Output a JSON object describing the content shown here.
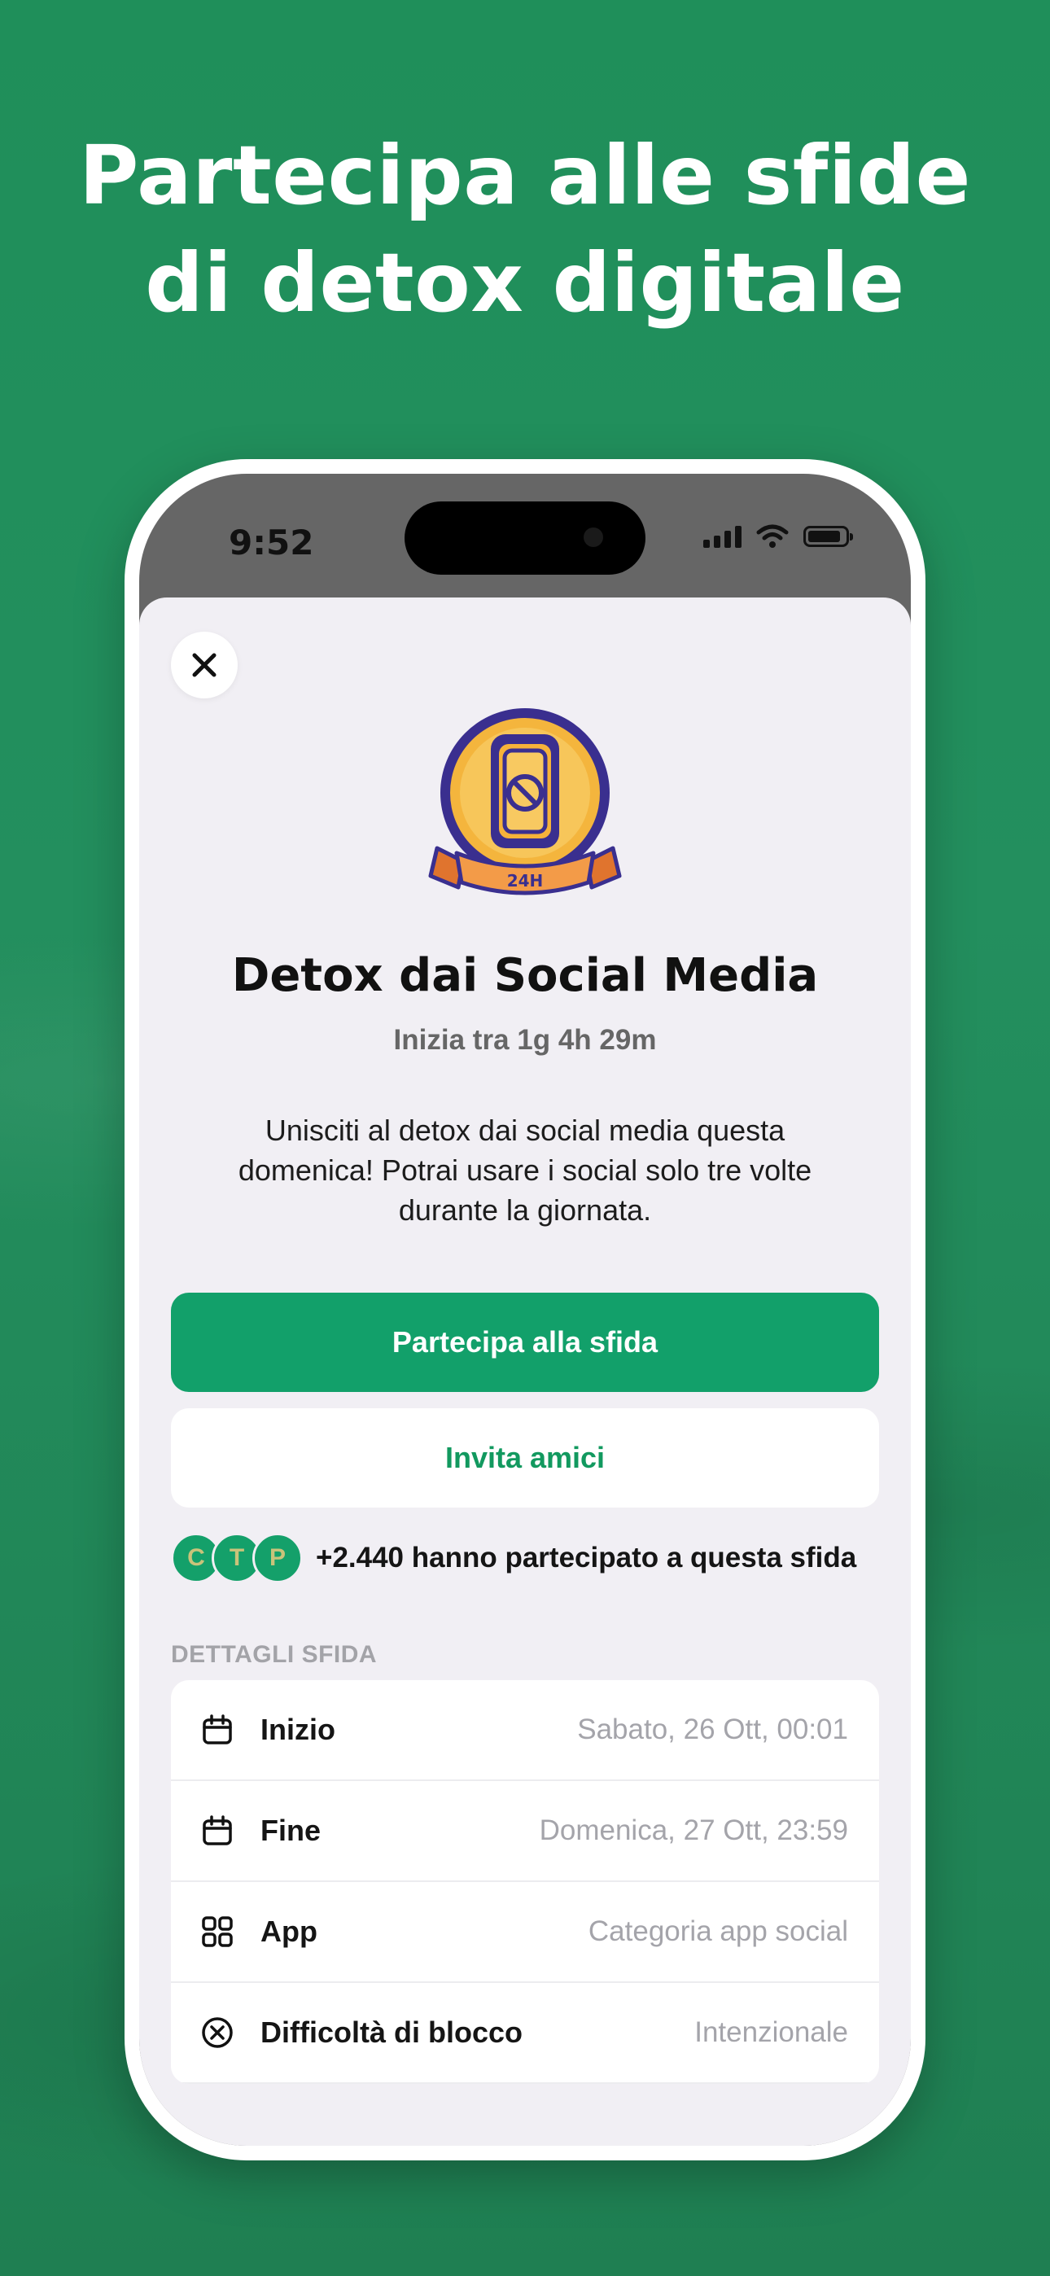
{
  "headline": {
    "line1": "Partecipa alle sfide",
    "line2": "di detox digitale"
  },
  "status_bar": {
    "time": "9:52",
    "icons": [
      "cellular-signal-icon",
      "wifi-icon",
      "battery-icon"
    ]
  },
  "challenge": {
    "badge_text": "24H",
    "title": "Detox dai Social Media",
    "countdown": "Inizia tra 1g 4h 29m",
    "description": "Unisciti al detox dai social media questa domenica! Potrai usare i social solo tre volte durante la giornata.",
    "join_label": "Partecipa alla sfida",
    "invite_label": "Invita amici"
  },
  "participants": {
    "avatars": [
      "C",
      "T",
      "P"
    ],
    "text": "+2.440 hanno partecipato a questa sfida"
  },
  "details": {
    "section_label": "DETTAGLI SFIDA",
    "rows": [
      {
        "icon": "calendar-icon",
        "label": "Inizio",
        "value": "Sabato, 26 Ott, 00:01"
      },
      {
        "icon": "calendar-icon",
        "label": "Fine",
        "value": "Domenica, 27 Ott, 23:59"
      },
      {
        "icon": "apps-grid-icon",
        "label": "App",
        "value": "Categoria app social"
      },
      {
        "icon": "circle-x-icon",
        "label": "Difficoltà di blocco",
        "value": "Intenzionale"
      }
    ]
  },
  "colors": {
    "background": "#1f8f5a",
    "accent": "#12a06a",
    "sheet": "#f1eff4"
  }
}
